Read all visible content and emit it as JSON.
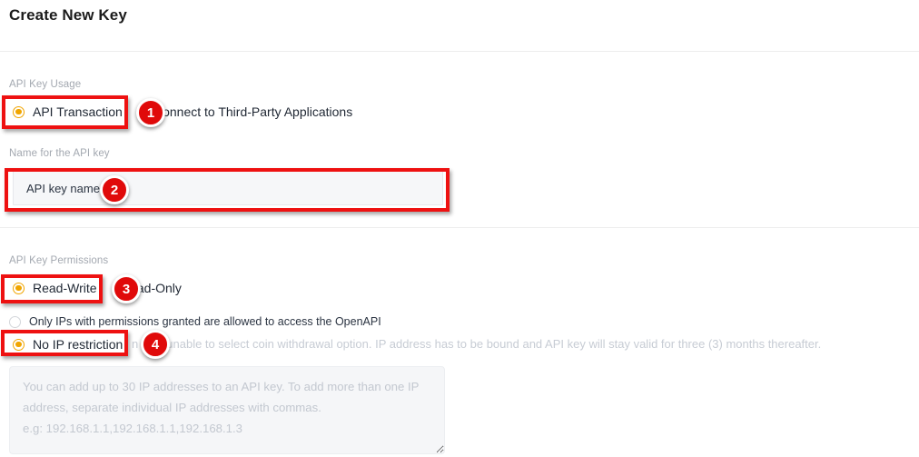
{
  "page": {
    "title": "Create New Key"
  },
  "sections": {
    "usage": {
      "label": "API Key Usage",
      "options": [
        {
          "label": "API Transaction",
          "checked": true
        },
        {
          "label": "Connect to Third-Party Applications",
          "checked": false
        }
      ]
    },
    "name": {
      "label": "Name for the API key",
      "input_placeholder": "API key name",
      "input_value": ""
    },
    "permissions": {
      "label": "API Key Permissions",
      "options": [
        {
          "label": "Read-Write",
          "checked": true
        },
        {
          "label": "Read-Only",
          "checked": false
        }
      ],
      "ip_options": [
        {
          "label": "Only IPs with permissions granted are allowed to access the OpenAPI",
          "checked": false
        },
        {
          "label": "No IP restriction",
          "checked": true
        }
      ],
      "ip_warning": "Certain risk, unable to select coin withdrawal option. IP address has to be bound and API key will stay valid for three (3) months thereafter.",
      "ip_warning_visible": "n risk, unable to select coin withdrawal option. IP address has to be bound and API key will stay valid for three (3) months thereafter.",
      "ip_textarea_placeholder": "You can add up to 30 IP addresses to an API key. To add more than one IP address, separate individual IP addresses with commas.\ne.g: 192.168.1.1,192.168.1.1,192.168.1.3",
      "ip_textarea_value": ""
    }
  },
  "annotations": {
    "badges": [
      {
        "number": "1",
        "target": "API Transaction"
      },
      {
        "number": "2",
        "target": "API key name input"
      },
      {
        "number": "3",
        "target": "Read-Write"
      },
      {
        "number": "4",
        "target": "No IP restriction"
      }
    ],
    "highlight_color": "#ee1111",
    "badge_color": "#e00a0a"
  },
  "colors": {
    "radio_accent": "#f0a500",
    "muted_text": "#a3a8b0",
    "body_text": "#1f2733",
    "input_background": "#f6f7f9",
    "page_background": "#ffffff"
  }
}
